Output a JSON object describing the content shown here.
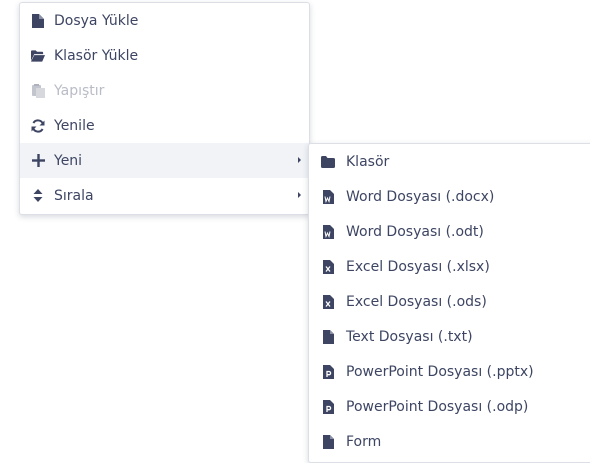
{
  "colors": {
    "text": "#3d4563",
    "disabled": "#b9bcc6",
    "active_bg": "#f1f3f7"
  },
  "context_menu": {
    "items": [
      {
        "label": "Dosya Yükle",
        "icon": "file-upload-icon"
      },
      {
        "label": "Klasör Yükle",
        "icon": "folder-open-icon"
      },
      {
        "label": "Yapıştır",
        "icon": "paste-icon",
        "disabled": true
      },
      {
        "label": "Yenile",
        "icon": "refresh-icon"
      },
      {
        "label": "Yeni",
        "icon": "plus-icon",
        "submenu": true,
        "active": true
      },
      {
        "label": "Sırala",
        "icon": "sort-icon",
        "submenu": true
      }
    ]
  },
  "new_submenu": {
    "items": [
      {
        "label": "Klasör",
        "icon": "folder-icon"
      },
      {
        "label": "Word Dosyası (.docx)",
        "icon": "word-file-icon"
      },
      {
        "label": "Word Dosyası (.odt)",
        "icon": "word-file-icon"
      },
      {
        "label": "Excel Dosyası (.xlsx)",
        "icon": "excel-file-icon"
      },
      {
        "label": "Excel Dosyası (.ods)",
        "icon": "excel-file-icon"
      },
      {
        "label": "Text Dosyası (.txt)",
        "icon": "text-file-icon"
      },
      {
        "label": "PowerPoint Dosyası (.pptx)",
        "icon": "powerpoint-file-icon"
      },
      {
        "label": "PowerPoint Dosyası (.odp)",
        "icon": "powerpoint-file-icon"
      },
      {
        "label": "Form",
        "icon": "form-icon"
      }
    ]
  }
}
